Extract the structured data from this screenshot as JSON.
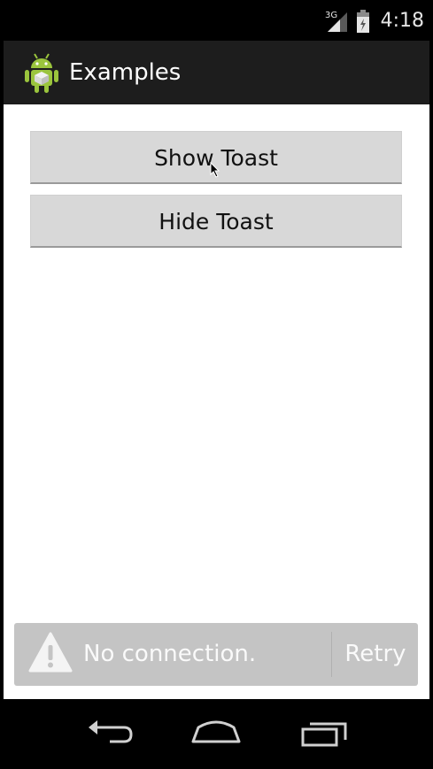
{
  "status_bar": {
    "network_label": "3G",
    "time": "4:18"
  },
  "action_bar": {
    "title": "Examples"
  },
  "buttons": {
    "show_toast": "Show Toast",
    "hide_toast": "Hide Toast"
  },
  "snackbar": {
    "message": "No connection.",
    "action": "Retry"
  },
  "icons": {
    "app": "android-icon",
    "warning": "warning-icon",
    "back": "back-icon",
    "home": "home-icon",
    "recent": "recent-apps-icon"
  },
  "colors": {
    "action_bar_bg": "#1d1d1d",
    "button_bg": "#d8d8d8",
    "snackbar_bg": "#c4c4c4",
    "android_green": "#9bc53d"
  }
}
